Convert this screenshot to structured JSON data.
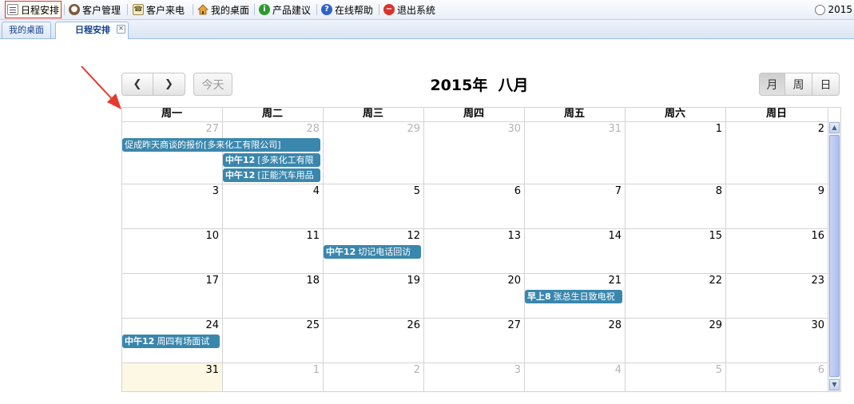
{
  "toolbar": {
    "items": [
      {
        "label": "日程安排",
        "icon": "calendar-list-icon"
      },
      {
        "label": "客户管理",
        "icon": "user-icon"
      },
      {
        "label": "客户来电",
        "icon": "phone-icon"
      },
      {
        "label": "我的桌面",
        "icon": "home-icon"
      },
      {
        "label": "产品建议",
        "icon": "info-icon"
      },
      {
        "label": "在线帮助",
        "icon": "help-icon"
      },
      {
        "label": "退出系统",
        "icon": "logout-icon"
      }
    ],
    "clock_text": "2015"
  },
  "tabs": [
    {
      "label": "我的桌面"
    },
    {
      "label": "日程安排",
      "close": "✕"
    }
  ],
  "calendar": {
    "prev_glyph": "❮",
    "next_glyph": "❯",
    "today_label": "今天",
    "title": "2015年  八月",
    "views": [
      "月",
      "周",
      "日"
    ],
    "active_view": "月",
    "day_names": [
      "周一",
      "周二",
      "周三",
      "周四",
      "周五",
      "周六",
      "周日"
    ],
    "weeks": [
      [
        {
          "d": "27",
          "other": true
        },
        {
          "d": "28",
          "other": true
        },
        {
          "d": "29",
          "other": true
        },
        {
          "d": "30",
          "other": true
        },
        {
          "d": "31",
          "other": true
        },
        {
          "d": "1"
        },
        {
          "d": "2"
        }
      ],
      [
        {
          "d": "3"
        },
        {
          "d": "4"
        },
        {
          "d": "5"
        },
        {
          "d": "6"
        },
        {
          "d": "7"
        },
        {
          "d": "8"
        },
        {
          "d": "9"
        }
      ],
      [
        {
          "d": "10"
        },
        {
          "d": "11"
        },
        {
          "d": "12"
        },
        {
          "d": "13"
        },
        {
          "d": "14"
        },
        {
          "d": "15"
        },
        {
          "d": "16"
        }
      ],
      [
        {
          "d": "17"
        },
        {
          "d": "18"
        },
        {
          "d": "19"
        },
        {
          "d": "20"
        },
        {
          "d": "21"
        },
        {
          "d": "22"
        },
        {
          "d": "23"
        }
      ],
      [
        {
          "d": "24"
        },
        {
          "d": "25"
        },
        {
          "d": "26"
        },
        {
          "d": "27"
        },
        {
          "d": "28"
        },
        {
          "d": "29"
        },
        {
          "d": "30"
        }
      ],
      [
        {
          "d": "31",
          "today": true
        },
        {
          "d": "1",
          "other": true
        },
        {
          "d": "2",
          "other": true
        },
        {
          "d": "3",
          "other": true
        },
        {
          "d": "4",
          "other": true
        },
        {
          "d": "5",
          "other": true
        },
        {
          "d": "6",
          "other": true
        }
      ]
    ],
    "events": [
      {
        "week": 0,
        "col": 0,
        "span": 2,
        "row": 0,
        "time": "",
        "title": "促成昨天商谈的报价[多来化工有限公司]"
      },
      {
        "week": 0,
        "col": 1,
        "span": 1,
        "row": 1,
        "time": "中午12",
        "title": "[多来化工有限"
      },
      {
        "week": 0,
        "col": 1,
        "span": 1,
        "row": 2,
        "time": "中午12",
        "title": "[正能汽车用品"
      },
      {
        "week": 2,
        "col": 2,
        "span": 1,
        "row": 0,
        "time": "中午12",
        "title": "切记电话回访"
      },
      {
        "week": 3,
        "col": 4,
        "span": 1,
        "row": 0,
        "time": "早上8",
        "title": "张总生日致电祝"
      },
      {
        "week": 4,
        "col": 0,
        "span": 1,
        "row": 0,
        "time": "中午12",
        "title": "周四有场面试"
      }
    ],
    "event_color": "#3a87ad",
    "today_color": "#fcf8e3"
  }
}
